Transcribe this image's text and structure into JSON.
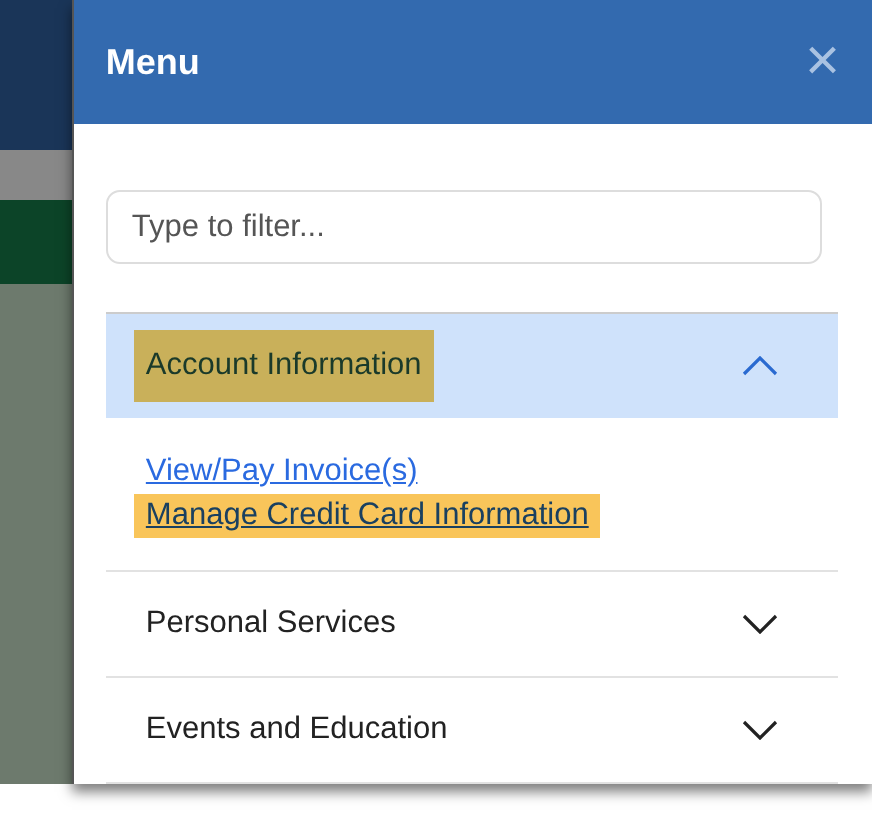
{
  "menu": {
    "title": "Menu",
    "close_icon": "×"
  },
  "filter": {
    "placeholder": "Type to filter..."
  },
  "sections": [
    {
      "label": "Account Information",
      "expanded": true,
      "highlighted": true,
      "links": [
        {
          "label": "View/Pay Invoice(s)",
          "highlighted": false
        },
        {
          "label": "Manage Credit Card Information",
          "highlighted": true
        }
      ]
    },
    {
      "label": "Personal Services",
      "expanded": false,
      "highlighted": false
    },
    {
      "label": "Events and Education",
      "expanded": false,
      "highlighted": false
    }
  ]
}
